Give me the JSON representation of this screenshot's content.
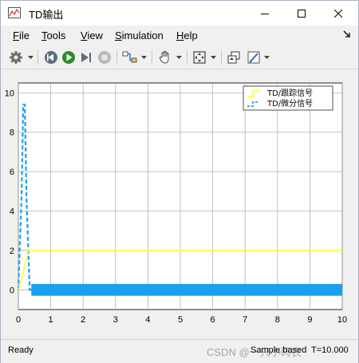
{
  "window": {
    "title": "TD输出"
  },
  "menu": {
    "items": [
      {
        "label": "File",
        "mnemonic": "F",
        "rest": "ile"
      },
      {
        "label": "Tools",
        "mnemonic": "T",
        "rest": "ools"
      },
      {
        "label": "View",
        "mnemonic": "V",
        "rest": "iew"
      },
      {
        "label": "Simulation",
        "mnemonic": "S",
        "rest": "imulation"
      },
      {
        "label": "Help",
        "mnemonic": "H",
        "rest": "elp"
      }
    ]
  },
  "toolbar": {
    "icons": [
      "settings-icon",
      "step-back-icon",
      "run-icon",
      "step-forward-icon",
      "stop-icon",
      "highlight-icon",
      "pan-icon",
      "autoscale-icon",
      "restore-icon",
      "style-icon"
    ]
  },
  "colors": {
    "tracking": "#ffff33",
    "derivative": "#1aa0f0",
    "plot_bg": "#ffffff",
    "grid": "#b0b0b0"
  },
  "chart_data": {
    "type": "line",
    "title": "",
    "xlabel": "",
    "ylabel": "",
    "xlim": [
      0,
      10
    ],
    "ylim": [
      -1,
      10.5
    ],
    "xticks": [
      "0",
      "1",
      "2",
      "3",
      "4",
      "5",
      "6",
      "7",
      "8",
      "9",
      "10"
    ],
    "yticks": [
      "0",
      "2",
      "4",
      "6",
      "8",
      "10"
    ],
    "grid": true,
    "legend_position": "top-right",
    "series": [
      {
        "name": "TD/跟踪信号",
        "style": "solid",
        "x": [
          0,
          0.1,
          0.2,
          0.3,
          10
        ],
        "y": [
          0,
          0.5,
          1.3,
          2,
          2
        ]
      },
      {
        "name": "TD/微分信号",
        "style": "dashed",
        "x": [
          0,
          0.05,
          0.1,
          0.15,
          0.2,
          0.25,
          0.3,
          0.35,
          0.4,
          10
        ],
        "y": [
          0,
          2.4,
          4.8,
          9.4,
          9.4,
          4.8,
          2.4,
          0,
          0,
          0
        ],
        "noise_band": [
          -0.3,
          0.3
        ],
        "noise_start": 0.4
      }
    ]
  },
  "status": {
    "ready": "Ready",
    "mode": "Sample based",
    "time": "T=10.000"
  },
  "watermark": "CSDN @一只小码农"
}
